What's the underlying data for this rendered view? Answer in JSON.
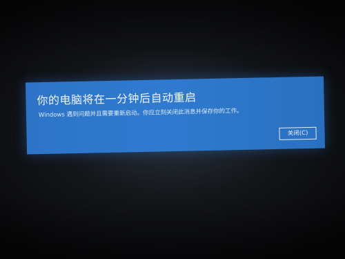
{
  "dialog": {
    "title": "你的电脑将在一分钟后自动重启",
    "message": "Windows 遇到问题并且需要重新启动。你应立刻关闭此消息并保存你的工作。",
    "close_label": "关闭(C)"
  },
  "colors": {
    "dialog_background": "#2f7bd0",
    "screen_background": "#121418",
    "text": "#f2f6fb"
  }
}
